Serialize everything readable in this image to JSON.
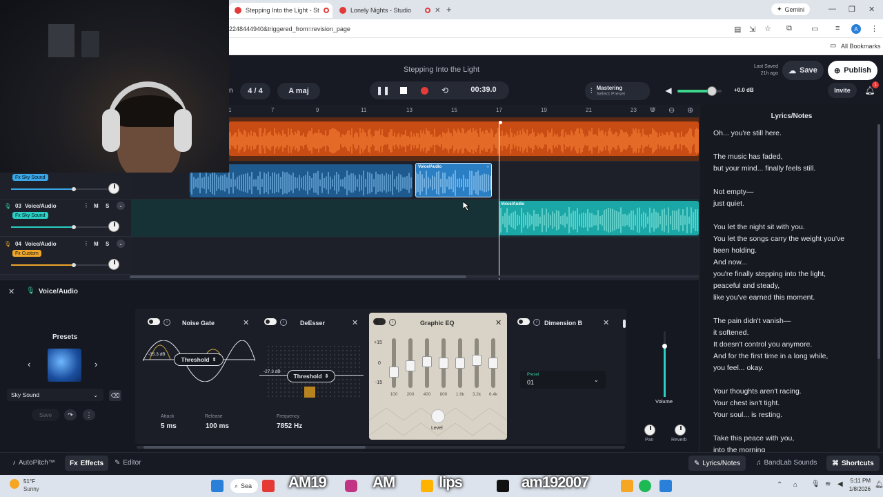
{
  "browser": {
    "tabs": [
      {
        "label": "Stepping Into the Light - St"
      },
      {
        "label": "Lonely Nights - Studio"
      }
    ],
    "new_tab": "+",
    "profile": "Gemini",
    "url_fragment": "2248444940&triggered_from=revision_page",
    "all_bookmarks": "All Bookmarks",
    "avatar_letter": "A"
  },
  "header": {
    "song_title": "Stepping Into the Light",
    "last_saved_label": "Last Saved",
    "last_saved_time": "21h ago",
    "save_label": "Save",
    "publish_label": "Publish",
    "invite_label": "Invite",
    "notification_count": "1"
  },
  "transport": {
    "n_label": "n",
    "time_signature": "4 / 4",
    "key": "A maj",
    "time": "00:39.0",
    "mastering_label": "Mastering",
    "mastering_preset": "Select Preset",
    "master_volume": 0.78,
    "master_db": "+0.0 dB"
  },
  "ruler": {
    "marks": [
      "7",
      "9",
      "11",
      "13",
      "15",
      "17",
      "19",
      "21",
      "23"
    ]
  },
  "tracks": [
    {
      "fx": "Fx Sky Sound",
      "fx_color": "#3aa7e8",
      "volume": 0.65
    },
    {
      "number": "03",
      "name": "Voice/Audio",
      "m": "M",
      "s": "S",
      "fx": "Fx Sky Sound",
      "fx_color": "#2ad0c4",
      "volume": 0.65
    },
    {
      "number": "04",
      "name": "Voice/Audio",
      "m": "M",
      "s": "S",
      "fx": "Fx Custom",
      "fx_color": "#f0a62a",
      "volume": 0.65
    }
  ],
  "clips": {
    "selected_label": "Voice/Audio",
    "teal_label": "Voice/Audio"
  },
  "lyrics": {
    "title": "Lyrics/Notes",
    "lines": [
      "Oh... you're still here.",
      "",
      "The music has faded,",
      "but your mind... finally feels still.",
      "",
      "Not empty—",
      "just quiet.",
      "",
      "You let the night sit with you.",
      "You let the songs carry the weight you've",
      "been holding.",
      "And now...",
      "you're finally stepping into the light,",
      "peaceful and steady,",
      "like you've earned this moment.",
      "",
      "The pain didn't vanish—",
      "it softened.",
      "It doesn't control you anymore.",
      "And for the first time in a long while,",
      "you feel... okay.",
      "",
      "Your thoughts aren't racing.",
      "Your chest isn't tight.",
      "Your soul... is resting.",
      "",
      "Take this peace with you,",
      "into the morning"
    ]
  },
  "fx_panel": {
    "track_label": "Voice/Audio",
    "presets_title": "Presets",
    "preset_name": "Sky Sound",
    "save_label": "Save",
    "noise_gate": {
      "title": "Noise Gate",
      "db": "-35.3 dB",
      "threshold": "Threshold",
      "attack_label": "Attack",
      "attack_value": "5 ms",
      "release_label": "Release",
      "release_value": "100 ms"
    },
    "deesser": {
      "title": "DeEsser",
      "db": "-27.3 dB",
      "threshold": "Threshold",
      "frequency_label": "Frequency",
      "frequency_value": "7852 Hz"
    },
    "eq": {
      "title": "Graphic EQ",
      "scale": [
        "+15",
        "0",
        "-15"
      ],
      "bands": [
        "100",
        "200",
        "400",
        "800",
        "1.6k",
        "3.2k",
        "6.4k"
      ],
      "gains": [
        -6,
        -2,
        1,
        0,
        0,
        2,
        0
      ],
      "level_label": "Level"
    },
    "dimension": {
      "title": "Dimension B",
      "preset_label": "Preset",
      "preset_value": "01"
    },
    "volume_label": "Volume",
    "volume_level": 0.78,
    "pan_label": "Pan",
    "reverb_label": "Reverb"
  },
  "bottom": {
    "autopitch": "AutoPitch™",
    "effects": "Effects",
    "editor": "Editor",
    "lyrics_notes": "Lyrics/Notes",
    "bandlab_sounds": "BandLab Sounds",
    "shortcuts": "Shortcuts"
  },
  "taskbar": {
    "temp": "51°F",
    "weather": "Sunny",
    "search": "Sea",
    "clock_time": "5:11 PM",
    "clock_date": "1/8/2026",
    "overlay_1": "AM19",
    "overlay_2": "AM",
    "overlay_3": "lips",
    "overlay_4": "am192007"
  },
  "colors": {
    "orange_clip": "#e8641c",
    "blue_clip": "#2a7fc4",
    "teal_clip": "#1ca7a7",
    "eq_card": "#d8d3c6",
    "accent": "#3aa7e8"
  }
}
